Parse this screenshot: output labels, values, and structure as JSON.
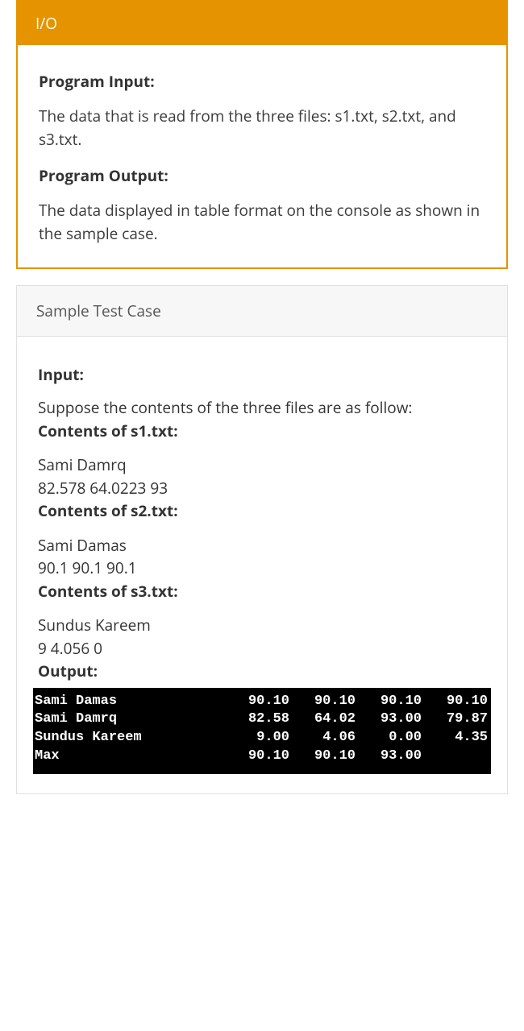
{
  "io": {
    "tab_label": "I/O",
    "program_input_heading": "Program Input:",
    "program_input_text": "The data that is read from the three files: s1.txt, s2.txt, and s3.txt.",
    "program_output_heading": "Program Output:",
    "program_output_text": "The data displayed in table format on the console as shown in the sample case."
  },
  "sample": {
    "title": "Sample Test Case",
    "input_heading": "Input:",
    "intro": "Suppose the contents of the three files are as follow:",
    "s1_label": "Contents of s1.txt:",
    "s1_name": "Sami Damrq",
    "s1_values": "82.578 64.0223 93",
    "s2_label": "Contents of s2.txt:",
    "s2_name": "Sami Damas",
    "s2_values": "90.1 90.1 90.1",
    "s3_label": "Contents of s3.txt:",
    "s3_name": "Sundus Kareem",
    "s3_values": "9 4.056 0",
    "output_heading": "Output:"
  },
  "console_rows": [
    {
      "name": "Sami Damas",
      "c1": "90.10",
      "c2": "90.10",
      "c3": "90.10",
      "c4": "90.10"
    },
    {
      "name": "Sami Damrq",
      "c1": "82.58",
      "c2": "64.02",
      "c3": "93.00",
      "c4": "79.87"
    },
    {
      "name": "Sundus Kareem",
      "c1": "9.00",
      "c2": "4.06",
      "c3": "0.00",
      "c4": "4.35"
    },
    {
      "name": "Max",
      "c1": "90.10",
      "c2": "90.10",
      "c3": "93.00",
      "c4": ""
    }
  ]
}
